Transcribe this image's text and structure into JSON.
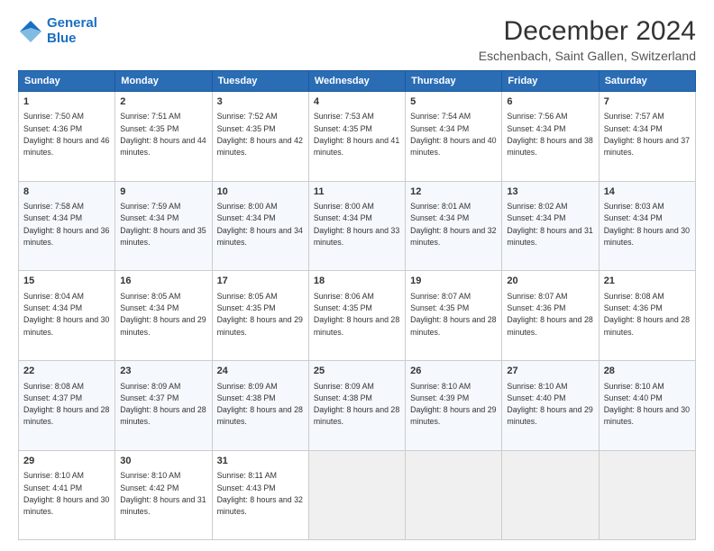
{
  "header": {
    "logo_line1": "General",
    "logo_line2": "Blue",
    "month": "December 2024",
    "location": "Eschenbach, Saint Gallen, Switzerland"
  },
  "weekdays": [
    "Sunday",
    "Monday",
    "Tuesday",
    "Wednesday",
    "Thursday",
    "Friday",
    "Saturday"
  ],
  "weeks": [
    [
      {
        "day": "1",
        "sunrise": "7:50 AM",
        "sunset": "4:36 PM",
        "daylight": "8 hours and 46 minutes."
      },
      {
        "day": "2",
        "sunrise": "7:51 AM",
        "sunset": "4:35 PM",
        "daylight": "8 hours and 44 minutes."
      },
      {
        "day": "3",
        "sunrise": "7:52 AM",
        "sunset": "4:35 PM",
        "daylight": "8 hours and 42 minutes."
      },
      {
        "day": "4",
        "sunrise": "7:53 AM",
        "sunset": "4:35 PM",
        "daylight": "8 hours and 41 minutes."
      },
      {
        "day": "5",
        "sunrise": "7:54 AM",
        "sunset": "4:34 PM",
        "daylight": "8 hours and 40 minutes."
      },
      {
        "day": "6",
        "sunrise": "7:56 AM",
        "sunset": "4:34 PM",
        "daylight": "8 hours and 38 minutes."
      },
      {
        "day": "7",
        "sunrise": "7:57 AM",
        "sunset": "4:34 PM",
        "daylight": "8 hours and 37 minutes."
      }
    ],
    [
      {
        "day": "8",
        "sunrise": "7:58 AM",
        "sunset": "4:34 PM",
        "daylight": "8 hours and 36 minutes."
      },
      {
        "day": "9",
        "sunrise": "7:59 AM",
        "sunset": "4:34 PM",
        "daylight": "8 hours and 35 minutes."
      },
      {
        "day": "10",
        "sunrise": "8:00 AM",
        "sunset": "4:34 PM",
        "daylight": "8 hours and 34 minutes."
      },
      {
        "day": "11",
        "sunrise": "8:00 AM",
        "sunset": "4:34 PM",
        "daylight": "8 hours and 33 minutes."
      },
      {
        "day": "12",
        "sunrise": "8:01 AM",
        "sunset": "4:34 PM",
        "daylight": "8 hours and 32 minutes."
      },
      {
        "day": "13",
        "sunrise": "8:02 AM",
        "sunset": "4:34 PM",
        "daylight": "8 hours and 31 minutes."
      },
      {
        "day": "14",
        "sunrise": "8:03 AM",
        "sunset": "4:34 PM",
        "daylight": "8 hours and 30 minutes."
      }
    ],
    [
      {
        "day": "15",
        "sunrise": "8:04 AM",
        "sunset": "4:34 PM",
        "daylight": "8 hours and 30 minutes."
      },
      {
        "day": "16",
        "sunrise": "8:05 AM",
        "sunset": "4:34 PM",
        "daylight": "8 hours and 29 minutes."
      },
      {
        "day": "17",
        "sunrise": "8:05 AM",
        "sunset": "4:35 PM",
        "daylight": "8 hours and 29 minutes."
      },
      {
        "day": "18",
        "sunrise": "8:06 AM",
        "sunset": "4:35 PM",
        "daylight": "8 hours and 28 minutes."
      },
      {
        "day": "19",
        "sunrise": "8:07 AM",
        "sunset": "4:35 PM",
        "daylight": "8 hours and 28 minutes."
      },
      {
        "day": "20",
        "sunrise": "8:07 AM",
        "sunset": "4:36 PM",
        "daylight": "8 hours and 28 minutes."
      },
      {
        "day": "21",
        "sunrise": "8:08 AM",
        "sunset": "4:36 PM",
        "daylight": "8 hours and 28 minutes."
      }
    ],
    [
      {
        "day": "22",
        "sunrise": "8:08 AM",
        "sunset": "4:37 PM",
        "daylight": "8 hours and 28 minutes."
      },
      {
        "day": "23",
        "sunrise": "8:09 AM",
        "sunset": "4:37 PM",
        "daylight": "8 hours and 28 minutes."
      },
      {
        "day": "24",
        "sunrise": "8:09 AM",
        "sunset": "4:38 PM",
        "daylight": "8 hours and 28 minutes."
      },
      {
        "day": "25",
        "sunrise": "8:09 AM",
        "sunset": "4:38 PM",
        "daylight": "8 hours and 28 minutes."
      },
      {
        "day": "26",
        "sunrise": "8:10 AM",
        "sunset": "4:39 PM",
        "daylight": "8 hours and 29 minutes."
      },
      {
        "day": "27",
        "sunrise": "8:10 AM",
        "sunset": "4:40 PM",
        "daylight": "8 hours and 29 minutes."
      },
      {
        "day": "28",
        "sunrise": "8:10 AM",
        "sunset": "4:40 PM",
        "daylight": "8 hours and 30 minutes."
      }
    ],
    [
      {
        "day": "29",
        "sunrise": "8:10 AM",
        "sunset": "4:41 PM",
        "daylight": "8 hours and 30 minutes."
      },
      {
        "day": "30",
        "sunrise": "8:10 AM",
        "sunset": "4:42 PM",
        "daylight": "8 hours and 31 minutes."
      },
      {
        "day": "31",
        "sunrise": "8:11 AM",
        "sunset": "4:43 PM",
        "daylight": "8 hours and 32 minutes."
      },
      null,
      null,
      null,
      null
    ]
  ]
}
